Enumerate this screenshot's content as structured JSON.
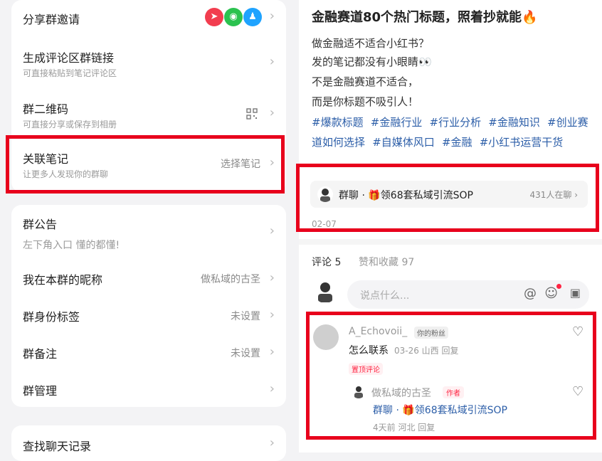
{
  "left": {
    "card1": {
      "share_invite": "分享群邀请",
      "generate_link": {
        "title": "生成评论区群链接",
        "sub": "可直接粘贴到笔记评论区"
      },
      "qrcode": {
        "title": "群二维码",
        "sub": "可直接分享或保存到相册"
      },
      "linked_note": {
        "title": "关联笔记",
        "sub": "让更多人发现你的群聊",
        "value": "选择笔记"
      }
    },
    "card2": {
      "announcement": {
        "title": "群公告",
        "sub": "左下角入口 懂的都懂!"
      },
      "nickname": {
        "title": "我在本群的昵称",
        "value": "做私域的古圣"
      },
      "id_tag": {
        "title": "群身份标签",
        "value": "未设置"
      },
      "remark": {
        "title": "群备注",
        "value": "未设置"
      },
      "manage": {
        "title": "群管理"
      }
    },
    "card3": {
      "search_history": "查找聊天记录"
    },
    "chevron": "›",
    "share_icons": [
      "send-icon",
      "wechat-icon",
      "qq-icon"
    ],
    "share_glyphs": [
      "➤",
      "◉",
      "♟"
    ],
    "share_colors": [
      "#f23d4f",
      "#2bc24f",
      "#1fa3ff"
    ]
  },
  "right": {
    "post": {
      "title": "金融赛道80个热门标题，照着抄就能🔥",
      "lines": [
        "做金融适不适合小红书？",
        "发的笔记都没有小眼睛👀",
        "不是金融赛道不适合，",
        "而是你标题不吸引人！"
      ],
      "tags": [
        "#爆款标题",
        "#金融行业",
        "#行业分析",
        "#金融知识",
        "#创业赛道如何选择",
        "#自媒体风口",
        "#金融",
        "#小红书运营干货"
      ]
    },
    "group_card": {
      "label": "群聊 · 🎁领68套私域引流SOP",
      "count": "431人在聊 ›"
    },
    "post_date": "02-07",
    "tabs": {
      "comments": "评论 5",
      "likes": "赞和收藏 97"
    },
    "comment_input": {
      "placeholder": "说点什么..."
    },
    "comment1": {
      "user": "A_Echovoii_",
      "badge": "你的粉丝",
      "text": "怎么联系",
      "meta": "03-26 山西 回复",
      "pin": "置顶评论"
    },
    "reply1": {
      "user": "做私域的古圣",
      "badge": "作者",
      "text": "群聊 · 🎁领68套私域引流SOP",
      "meta": "4天前 河北 回复"
    }
  }
}
